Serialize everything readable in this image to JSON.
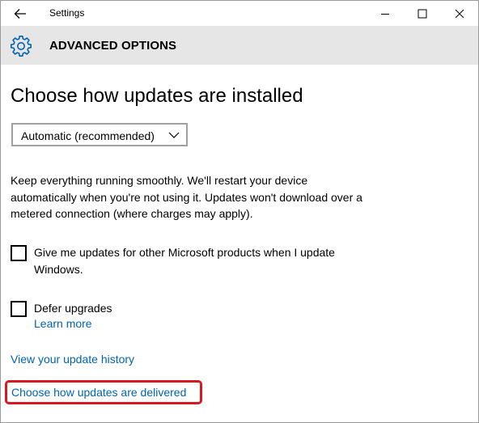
{
  "window": {
    "title": "Settings"
  },
  "header": {
    "title": "ADVANCED OPTIONS",
    "icon": "gear-icon"
  },
  "main": {
    "heading": "Choose how updates are installed",
    "dropdown": {
      "selected": "Automatic (recommended)"
    },
    "description": "Keep everything running smoothly. We'll restart your device automatically when you're not using it. Updates won't download over a metered connection (where charges may apply).",
    "checkboxes": [
      {
        "label": "Give me updates for other Microsoft products when I update Windows.",
        "checked": false
      },
      {
        "label": "Defer upgrades",
        "checked": false
      }
    ],
    "learn_more": "Learn more",
    "history_link": "View your update history",
    "delivered_link": "Choose how updates are delivered"
  },
  "colors": {
    "link": "#0063b1",
    "highlight": "#d71920",
    "header_bg": "#e6e6e6",
    "accent_icon": "#0063b1"
  }
}
